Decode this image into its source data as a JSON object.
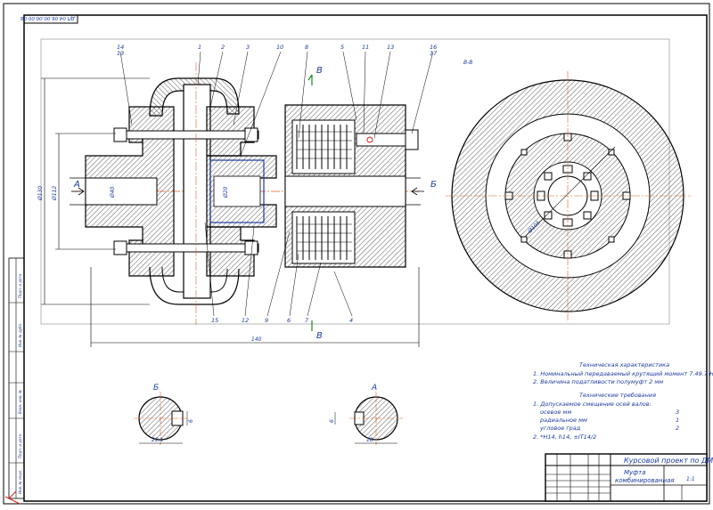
{
  "header": {
    "stamp": "ДП 04.06.00.00.00 СБ"
  },
  "view": {
    "section_label": "В-В"
  },
  "markers": {
    "a": "А",
    "b": "Б",
    "v_top": "В",
    "v_bottom": "В"
  },
  "dimensions": {
    "overall_length": "140",
    "left_height": "Ø130",
    "flange_dia": "Ø112",
    "hub_dia": "Ø40",
    "bore_dia": "Ø20",
    "circle_dia": "Ø105"
  },
  "callouts": {
    "top": [
      "14",
      "13",
      "1",
      "2",
      "3",
      "10",
      "8",
      "5",
      "11",
      "13",
      "16",
      "17"
    ],
    "bottom": [
      "15",
      "12",
      "9",
      "6",
      "7",
      "4"
    ]
  },
  "sections": {
    "b": {
      "label": "Б",
      "dim_width": "22.1",
      "dim_height": "6"
    },
    "a": {
      "label": "А",
      "dim_width": "18",
      "dim_height": "6"
    }
  },
  "specs": {
    "char_title": "Техническая характеристика",
    "char_lines": [
      "1. Номинальный передаваемый крутящий момент 7.49.7 Нм",
      "2. Величина податливости полумуфт 2 мм"
    ],
    "req_title": "Технические требования",
    "req_lines": [
      "1. Допускаемое смещение осей валов:",
      "осевое мм",
      "радиальное мм",
      "угловое град",
      "2. *Н14, h14, ±IT14/2"
    ],
    "req_values": [
      "3",
      "1",
      "2"
    ]
  },
  "title_block": {
    "project": "Курсовой проект по ДМ",
    "name_line1": "Муфта",
    "name_line2": "комбинированная",
    "sheet_scale": "1:1"
  },
  "side_strip": [
    "Инв. № подл.",
    "Подп. и дата",
    "Взам. инв. №",
    "Инв. № дубл.",
    "Подп. и дата"
  ]
}
